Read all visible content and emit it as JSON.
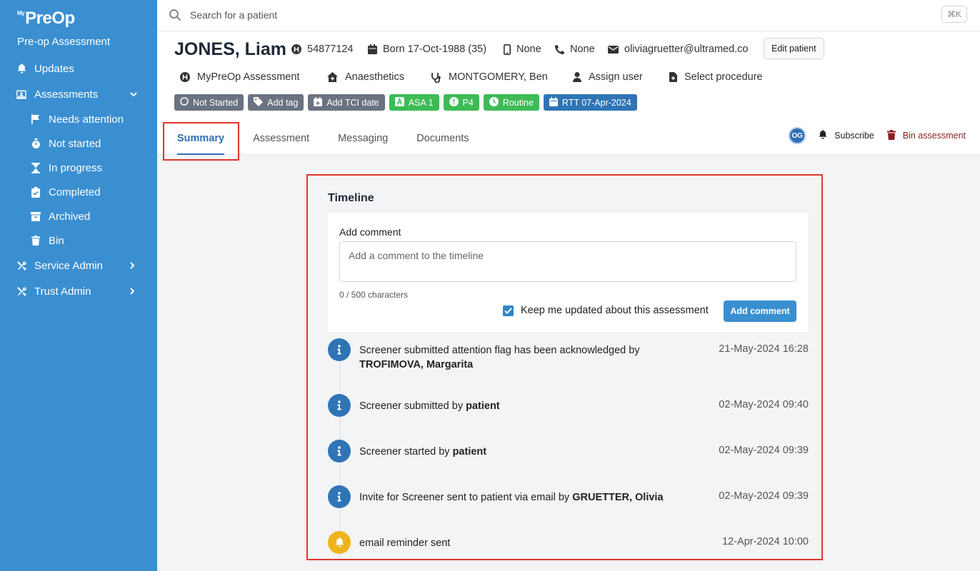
{
  "app": {
    "logo_prefix": "My",
    "logo": "PreOp",
    "title": "Pre-op Assessment"
  },
  "sidebar": {
    "items": [
      {
        "label": "Updates",
        "icon": "bell-icon"
      },
      {
        "label": "Assessments",
        "icon": "clipboard-icon",
        "expanded": true
      }
    ],
    "sub_items": [
      {
        "label": "Needs attention",
        "icon": "flag-icon"
      },
      {
        "label": "Not started",
        "icon": "stopwatch-icon"
      },
      {
        "label": "In progress",
        "icon": "hourglass-icon"
      },
      {
        "label": "Completed",
        "icon": "clipboard-check-icon"
      },
      {
        "label": "Archived",
        "icon": "archive-icon"
      },
      {
        "label": "Bin",
        "icon": "trash-icon"
      }
    ],
    "bottom_items": [
      {
        "label": "Service Admin",
        "icon": "tools-icon"
      },
      {
        "label": "Trust Admin",
        "icon": "tools-icon"
      }
    ]
  },
  "search": {
    "placeholder": "Search for a patient",
    "shortcut": "⌘K"
  },
  "patient": {
    "name": "JONES, Liam",
    "hospital_number": "54877124",
    "born": "Born 17-Oct-1988 (35)",
    "mobile": "None",
    "phone": "None",
    "email": "oliviagruetter@ultramed.co",
    "edit_label": "Edit patient"
  },
  "assessment": {
    "type": "MyPreOp Assessment",
    "specialty": "Anaesthetics",
    "clinician": "MONTGOMERY, Ben",
    "assign_user": "Assign user",
    "select_procedure": "Select procedure"
  },
  "tags": {
    "status": "Not Started",
    "add_tag": "Add tag",
    "add_tci": "Add TCI date",
    "asa": "ASA 1",
    "priority": "P4",
    "urgency": "Routine",
    "rtt": "RTT 07-Apr-2024"
  },
  "tabs": [
    "Summary",
    "Assessment",
    "Messaging",
    "Documents"
  ],
  "actions": {
    "avatar": "OG",
    "subscribe": "Subscribe",
    "bin": "Bin assessment"
  },
  "timeline": {
    "title": "Timeline",
    "comment_label": "Add comment",
    "comment_placeholder": "Add a comment to the timeline",
    "char_count": "0 / 500 characters",
    "keep_updated": "Keep me updated about this assessment",
    "keep_updated_checked": true,
    "add_button": "Add comment",
    "events": [
      {
        "text": "Screener submitted attention flag has been acknowledged by",
        "actor": "TROFIMOVA, Margarita",
        "time": "21-May-2024 16:28",
        "kind": "info"
      },
      {
        "text": "Screener submitted by",
        "actor": "patient",
        "time": "02-May-2024 09:40",
        "kind": "info"
      },
      {
        "text": "Screener started by",
        "actor": "patient",
        "time": "02-May-2024 09:39",
        "kind": "info"
      },
      {
        "text": "Invite for Screener sent to patient via email by",
        "actor": "GRUETTER, Olivia",
        "time": "02-May-2024 09:39",
        "kind": "info"
      },
      {
        "text": "email reminder sent",
        "actor": "",
        "time": "12-Apr-2024 10:00",
        "kind": "reminder"
      }
    ]
  },
  "colors": {
    "sidebar": "#3a8fd1",
    "highlight": "#e0362c",
    "primary": "#2f74b5",
    "green": "#3dbb56",
    "reminder": "#f0b41b"
  }
}
